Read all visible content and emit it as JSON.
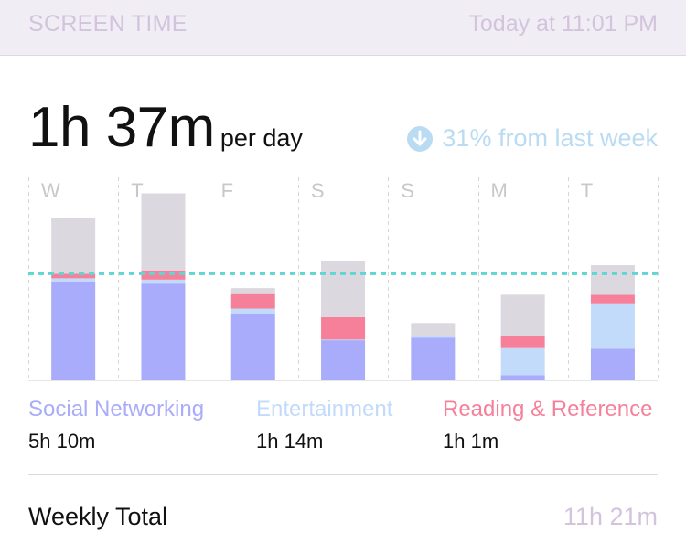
{
  "header": {
    "title": "SCREEN TIME",
    "timestamp": "Today at 11:01 PM"
  },
  "summary": {
    "average": "1h 37m",
    "average_unit": "per day",
    "change_icon": "arrow-down-circle-icon",
    "change_text": "31% from last week"
  },
  "colors": {
    "social": "#a9acfb",
    "entertainment": "#c2dbfa",
    "reading": "#f6809a",
    "other": "#dcd8df",
    "average_line": "#5ed6d2",
    "muted": "#d3c3dc"
  },
  "days": [
    "W",
    "T",
    "F",
    "S",
    "S",
    "M",
    "T"
  ],
  "usage_hours": [
    {
      "social": 1.5,
      "entertainment": 0.05,
      "reading": 0.07,
      "other": 0.85
    },
    {
      "social": 1.47,
      "entertainment": 0.06,
      "reading": 0.14,
      "other": 1.17
    },
    {
      "social": 1.0,
      "entertainment": 0.09,
      "reading": 0.22,
      "other": 0.09
    },
    {
      "social": 0.61,
      "entertainment": 0.01,
      "reading": 0.34,
      "other": 0.86
    },
    {
      "social": 0.65,
      "entertainment": 0.02,
      "reading": 0.01,
      "other": 0.19
    },
    {
      "social": 0.08,
      "entertainment": 0.41,
      "reading": 0.18,
      "other": 0.63
    },
    {
      "social": 0.48,
      "entertainment": 0.69,
      "reading": 0.13,
      "other": 0.45
    }
  ],
  "average_hours": 1.62,
  "legend": [
    {
      "label": "Social Networking",
      "value": "5h 10m"
    },
    {
      "label": "Entertainment",
      "value": "1h 14m"
    },
    {
      "label": "Reading & Reference",
      "value": "1h 1m"
    }
  ],
  "weekly": {
    "label": "Weekly Total",
    "value": "11h 21m"
  }
}
